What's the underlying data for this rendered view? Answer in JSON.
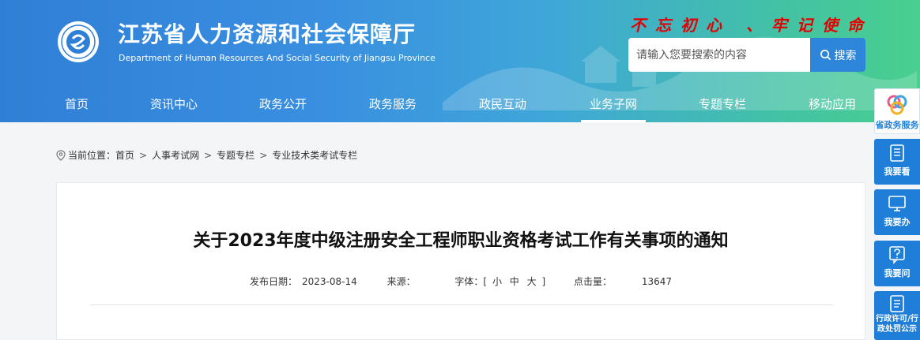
{
  "header": {
    "title": "江苏省人力资源和社会保障厅",
    "subtitle": "Department of Human Resources And Social Security of Jiangsu Province",
    "slogan": "不忘初心 、牢记使命"
  },
  "search": {
    "placeholder": "请输入您要搜索的内容",
    "button": "搜索"
  },
  "nav": {
    "items": [
      {
        "label": "首页"
      },
      {
        "label": "资讯中心"
      },
      {
        "label": "政务公开"
      },
      {
        "label": "政务服务"
      },
      {
        "label": "政民互动"
      },
      {
        "label": "业务子网",
        "active": true
      },
      {
        "label": "专题专栏"
      },
      {
        "label": "移动应用"
      }
    ]
  },
  "breadcrumb": {
    "prefix": "当前位置：",
    "items": [
      "首页",
      "人事考试网",
      "专题专栏",
      "专业技术类考试专栏"
    ],
    "separator": ">"
  },
  "article": {
    "title": "关于2023年度中级注册安全工程师职业资格考试工作有关事项的通知",
    "date_label": "发布日期：",
    "date": "2023-08-14",
    "source_label": "来源：",
    "source": "",
    "font_label": "字体：[",
    "font_small": "小",
    "font_medium": "中",
    "font_large": "大",
    "font_close": "]",
    "hits_label": "点击量：",
    "hits": "13647"
  },
  "sidebar": {
    "items": [
      {
        "label": "省政务服务",
        "icon": "gov-service-logo-icon"
      },
      {
        "label": "我要看",
        "icon": "book-icon"
      },
      {
        "label": "我要办",
        "icon": "monitor-icon"
      },
      {
        "label": "我要问",
        "icon": "question-icon"
      },
      {
        "label": "行政许可/行政处罚公示",
        "icon": "document-icon"
      }
    ]
  },
  "colors": {
    "header_start": "#2f7fd6",
    "header_end": "#49cf8e",
    "accent": "#1f7fd8",
    "slogan": "#e30000"
  }
}
